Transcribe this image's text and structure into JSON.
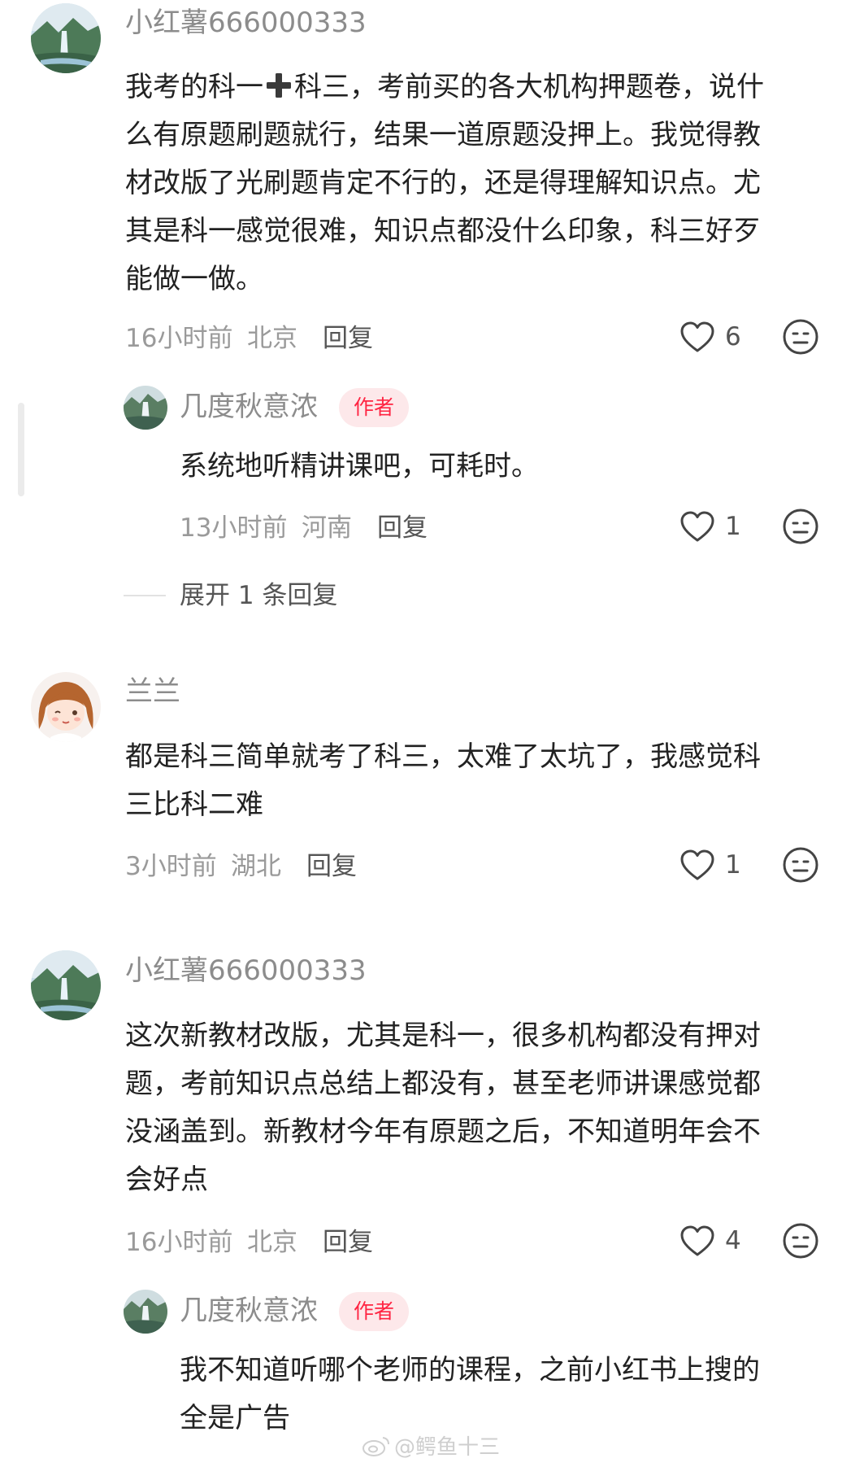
{
  "comments": [
    {
      "username": "小红薯666000333",
      "text_lines": [
        "我考的科一",
        "科三，考前买的各大机构押题卷，说什",
        "么有原题刷题就行，结果一道原题没押上。我觉得教",
        "材改版了光刷题肯定不行的，还是得理解知识点。尤",
        "其是科一感觉很难，知识点都没什么印象，科三好歹",
        "能做一做。"
      ],
      "time": "16小时前",
      "location": "北京",
      "reply_label": "回复",
      "likes": "6",
      "replies": [
        {
          "username": "几度秋意浓",
          "badge": "作者",
          "text_lines": [
            "系统地听精讲课吧，可耗时。"
          ],
          "time": "13小时前",
          "location": "河南",
          "reply_label": "回复",
          "likes": "1"
        }
      ],
      "expand_label": "展开 1 条回复"
    },
    {
      "username": "兰兰",
      "text_lines": [
        "都是科三简单就考了科三，太难了太坑了，我感觉科",
        "三比科二难"
      ],
      "time": "3小时前",
      "location": "湖北",
      "reply_label": "回复",
      "likes": "1"
    },
    {
      "username": "小红薯666000333",
      "text_lines": [
        "这次新教材改版，尤其是科一，很多机构都没有押对",
        "题，考前知识点总结上都没有，甚至老师讲课感觉都",
        "没涵盖到。新教材今年有原题之后，不知道明年会不",
        "会好点"
      ],
      "time": "16小时前",
      "location": "北京",
      "reply_label": "回复",
      "likes": "4",
      "replies": [
        {
          "username": "几度秋意浓",
          "badge": "作者",
          "text_lines": [
            "我不知道听哪个老师的课程，之前小红书上搜的",
            "全是广告"
          ]
        }
      ]
    }
  ],
  "watermark": "@鳄鱼十三",
  "colors": {
    "badge_bg": "#fde8ea",
    "badge_text": "#ff2442",
    "meta": "#9a9a9a",
    "name": "#8c8c8c"
  },
  "icons": [
    "heart-icon",
    "emoji-icon",
    "plus-icon",
    "weibo-icon"
  ]
}
